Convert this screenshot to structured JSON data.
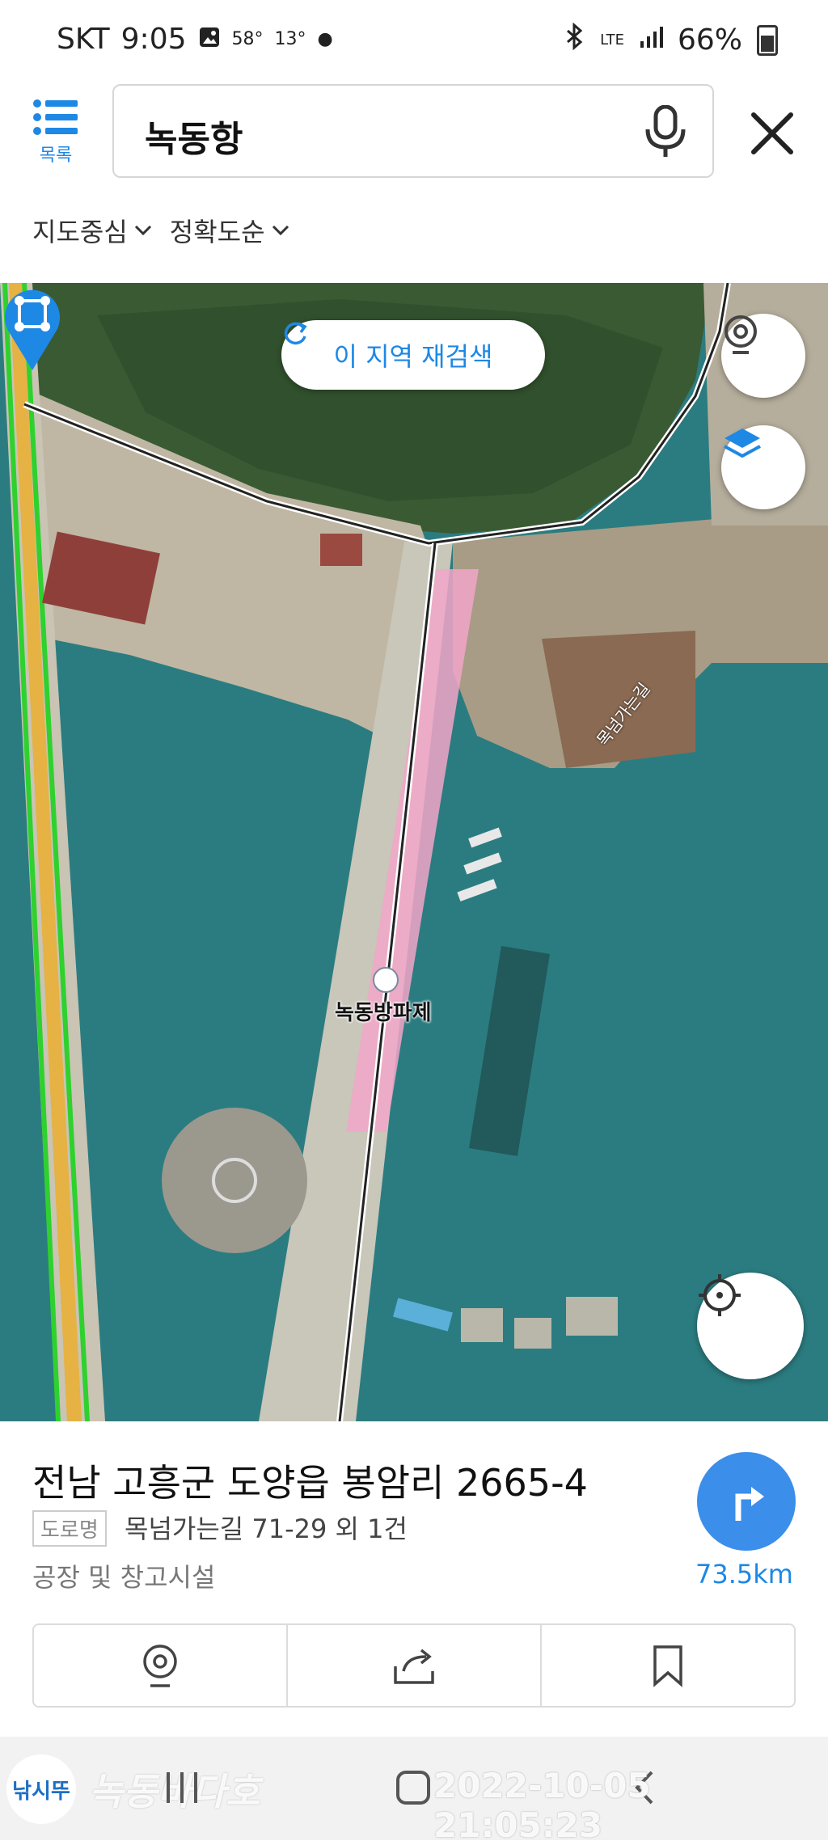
{
  "status": {
    "carrier": "SKT",
    "time": "9:05",
    "temp1": "58°",
    "temp2": "13°",
    "network": "LTE",
    "battery": "66%"
  },
  "search": {
    "list_label": "목록",
    "query": "녹동항"
  },
  "filters": [
    {
      "label": "지도중심"
    },
    {
      "label": "정확도순"
    }
  ],
  "map": {
    "research_label": "이 지역 재검색",
    "poi_label": "녹동방파제",
    "road_label": "목넘가는길"
  },
  "place": {
    "address": "전남 고흥군 도양읍 봉암리 2665-4",
    "road_tag": "도로명",
    "road_address": "목넘가는길 71-29 외 1건",
    "category": "공장 및 창고시설",
    "distance": "73.5km"
  },
  "watermark": {
    "logo": "낚시뚜",
    "text": "녹동바다호",
    "date": "2022-10-05 21:05:23"
  },
  "colors": {
    "accent": "#1e88e5",
    "sea": "#2d7f80",
    "highlight": "#f2a6c8"
  }
}
